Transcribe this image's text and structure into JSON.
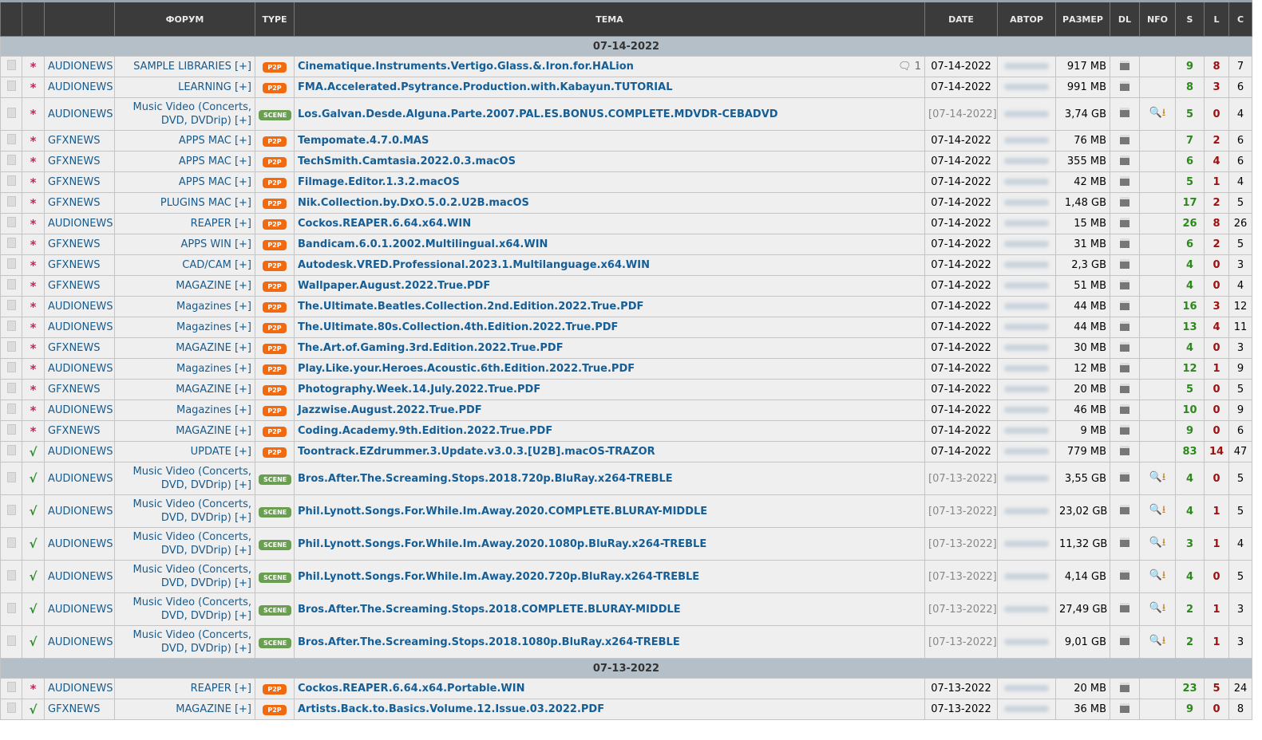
{
  "headers": [
    "",
    "",
    "",
    "ФОРУМ",
    "TYPE",
    "ТЕМА",
    "DATE",
    "АВТОР",
    "РАЗМЕР",
    "DL",
    "NFO",
    "S",
    "L",
    "C"
  ],
  "groups": [
    {
      "date": "07-14-2022",
      "rows": [
        [
          "*",
          "AUDIONEWS",
          "SAMPLE LIBRARIES [+]",
          "P2P",
          "Cinematique.Instruments.Vertigo.Glass.&.Iron.for.HALion",
          "07-14-2022",
          "917 MB",
          false,
          "9",
          "8",
          "7",
          "1"
        ],
        [
          "*",
          "AUDIONEWS",
          "LEARNING [+]",
          "P2P",
          "FMA.Accelerated.Psytrance.Production.with.Kabayun.TUTORIAL",
          "07-14-2022",
          "991 MB",
          false,
          "8",
          "3",
          "6",
          ""
        ],
        [
          "*",
          "AUDIONEWS",
          "Music Video (Concerts, DVD, DVDrip) [+]",
          "SCENE",
          "Los.Galvan.Desde.Alguna.Parte.2007.PAL.ES.BONUS.COMPLETE.MDVDR-CEBADVD",
          "[07-14-2022]",
          "3,74 GB",
          true,
          "5",
          "0",
          "4",
          ""
        ],
        [
          "*",
          "GFXNEWS",
          "APPS MAC [+]",
          "P2P",
          "Tempomate.4.7.0.MAS",
          "07-14-2022",
          "76 MB",
          false,
          "7",
          "2",
          "6",
          ""
        ],
        [
          "*",
          "GFXNEWS",
          "APPS MAC [+]",
          "P2P",
          "TechSmith.Camtasia.2022.0.3.macOS",
          "07-14-2022",
          "355 MB",
          false,
          "6",
          "4",
          "6",
          ""
        ],
        [
          "*",
          "GFXNEWS",
          "APPS MAC [+]",
          "P2P",
          "Filmage.Editor.1.3.2.macOS",
          "07-14-2022",
          "42 MB",
          false,
          "5",
          "1",
          "4",
          ""
        ],
        [
          "*",
          "GFXNEWS",
          "PLUGINS MAC [+]",
          "P2P",
          "Nik.Collection.by.DxO.5.0.2.U2B.macOS",
          "07-14-2022",
          "1,48 GB",
          false,
          "17",
          "2",
          "5",
          ""
        ],
        [
          "*",
          "AUDIONEWS",
          "REAPER [+]",
          "P2P",
          "Cockos.REAPER.6.64.x64.WIN",
          "07-14-2022",
          "15 MB",
          false,
          "26",
          "8",
          "26",
          ""
        ],
        [
          "*",
          "GFXNEWS",
          "APPS WIN [+]",
          "P2P",
          "Bandicam.6.0.1.2002.Multilingual.x64.WIN",
          "07-14-2022",
          "31 MB",
          false,
          "6",
          "2",
          "5",
          ""
        ],
        [
          "*",
          "GFXNEWS",
          "CAD/CAM [+]",
          "P2P",
          "Autodesk.VRED.Professional.2023.1.Multilanguage.x64.WIN",
          "07-14-2022",
          "2,3 GB",
          false,
          "4",
          "0",
          "3",
          ""
        ],
        [
          "*",
          "GFXNEWS",
          "MAGAZINE [+]",
          "P2P",
          "Wallpaper.August.2022.True.PDF",
          "07-14-2022",
          "51 MB",
          false,
          "4",
          "0",
          "4",
          ""
        ],
        [
          "*",
          "AUDIONEWS",
          "Magazines [+]",
          "P2P",
          "The.Ultimate.Beatles.Collection.2nd.Edition.2022.True.PDF",
          "07-14-2022",
          "44 MB",
          false,
          "16",
          "3",
          "12",
          ""
        ],
        [
          "*",
          "AUDIONEWS",
          "Magazines [+]",
          "P2P",
          "The.Ultimate.80s.Collection.4th.Edition.2022.True.PDF",
          "07-14-2022",
          "44 MB",
          false,
          "13",
          "4",
          "11",
          ""
        ],
        [
          "*",
          "GFXNEWS",
          "MAGAZINE [+]",
          "P2P",
          "The.Art.of.Gaming.3rd.Edition.2022.True.PDF",
          "07-14-2022",
          "30 MB",
          false,
          "4",
          "0",
          "3",
          ""
        ],
        [
          "*",
          "AUDIONEWS",
          "Magazines [+]",
          "P2P",
          "Play.Like.your.Heroes.Acoustic.6th.Edition.2022.True.PDF",
          "07-14-2022",
          "12 MB",
          false,
          "12",
          "1",
          "9",
          ""
        ],
        [
          "*",
          "GFXNEWS",
          "MAGAZINE [+]",
          "P2P",
          "Photography.Week.14.July.2022.True.PDF",
          "07-14-2022",
          "20 MB",
          false,
          "5",
          "0",
          "5",
          ""
        ],
        [
          "*",
          "AUDIONEWS",
          "Magazines [+]",
          "P2P",
          "Jazzwise.August.2022.True.PDF",
          "07-14-2022",
          "46 MB",
          false,
          "10",
          "0",
          "9",
          ""
        ],
        [
          "*",
          "GFXNEWS",
          "MAGAZINE [+]",
          "P2P",
          "Coding.Academy.9th.Edition.2022.True.PDF",
          "07-14-2022",
          "9 MB",
          false,
          "9",
          "0",
          "6",
          ""
        ],
        [
          "√",
          "AUDIONEWS",
          "UPDATE [+]",
          "P2P",
          "Toontrack.EZdrummer.3.Update.v3.0.3.[U2B].macOS-TRAZOR",
          "07-14-2022",
          "779 MB",
          false,
          "83",
          "14",
          "47",
          ""
        ],
        [
          "√",
          "AUDIONEWS",
          "Music Video (Concerts, DVD, DVDrip) [+]",
          "SCENE",
          "Bros.After.The.Screaming.Stops.2018.720p.BluRay.x264-TREBLE",
          "[07-13-2022]",
          "3,55 GB",
          true,
          "4",
          "0",
          "5",
          ""
        ],
        [
          "√",
          "AUDIONEWS",
          "Music Video (Concerts, DVD, DVDrip) [+]",
          "SCENE",
          "Phil.Lynott.Songs.For.While.Im.Away.2020.COMPLETE.BLURAY-MIDDLE",
          "[07-13-2022]",
          "23,02 GB",
          true,
          "4",
          "1",
          "5",
          ""
        ],
        [
          "√",
          "AUDIONEWS",
          "Music Video (Concerts, DVD, DVDrip) [+]",
          "SCENE",
          "Phil.Lynott.Songs.For.While.Im.Away.2020.1080p.BluRay.x264-TREBLE",
          "[07-13-2022]",
          "11,32 GB",
          true,
          "3",
          "1",
          "4",
          ""
        ],
        [
          "√",
          "AUDIONEWS",
          "Music Video (Concerts, DVD, DVDrip) [+]",
          "SCENE",
          "Phil.Lynott.Songs.For.While.Im.Away.2020.720p.BluRay.x264-TREBLE",
          "[07-13-2022]",
          "4,14 GB",
          true,
          "4",
          "0",
          "5",
          ""
        ],
        [
          "√",
          "AUDIONEWS",
          "Music Video (Concerts, DVD, DVDrip) [+]",
          "SCENE",
          "Bros.After.The.Screaming.Stops.2018.COMPLETE.BLURAY-MIDDLE",
          "[07-13-2022]",
          "27,49 GB",
          true,
          "2",
          "1",
          "3",
          ""
        ],
        [
          "√",
          "AUDIONEWS",
          "Music Video (Concerts, DVD, DVDrip) [+]",
          "SCENE",
          "Bros.After.The.Screaming.Stops.2018.1080p.BluRay.x264-TREBLE",
          "[07-13-2022]",
          "9,01 GB",
          true,
          "2",
          "1",
          "3",
          ""
        ]
      ]
    },
    {
      "date": "07-13-2022",
      "rows": [
        [
          "*",
          "AUDIONEWS",
          "REAPER [+]",
          "P2P",
          "Cockos.REAPER.6.64.x64.Portable.WIN",
          "07-13-2022",
          "20 MB",
          false,
          "23",
          "5",
          "24",
          ""
        ],
        [
          "√",
          "GFXNEWS",
          "MAGAZINE [+]",
          "P2P",
          "Artists.Back.to.Basics.Volume.12.Issue.03.2022.PDF",
          "07-13-2022",
          "36 MB",
          false,
          "9",
          "0",
          "8",
          ""
        ]
      ]
    }
  ]
}
